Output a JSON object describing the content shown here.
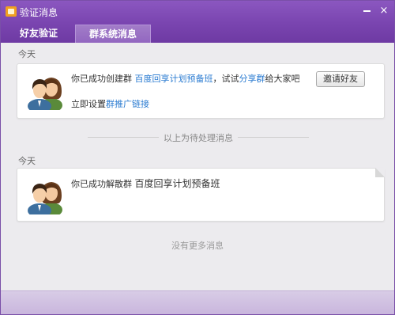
{
  "window": {
    "title": "验证消息",
    "min_label": "",
    "close_label": "×"
  },
  "tabs": [
    {
      "label": "好友验证"
    },
    {
      "label": "群系统消息"
    }
  ],
  "section1": {
    "date": "今天",
    "msg_prefix": "你已成功创建群 ",
    "group_name": "百度回享计划预备班",
    "msg_middle": "，试试",
    "share_link": "分享群",
    "msg_suffix": "给大家吧",
    "setup_prefix": "立即设置",
    "setup_link": "群推广链接",
    "invite_button": "邀请好友"
  },
  "divider": {
    "text": "以上为待处理消息"
  },
  "section2": {
    "date": "今天",
    "msg_prefix": "你已成功解散群 ",
    "group_name": "百度回享计划预备班"
  },
  "footer": {
    "no_more": "没有更多消息"
  },
  "colors": {
    "accent": "#7a45b0",
    "link": "#2a7bd1"
  }
}
